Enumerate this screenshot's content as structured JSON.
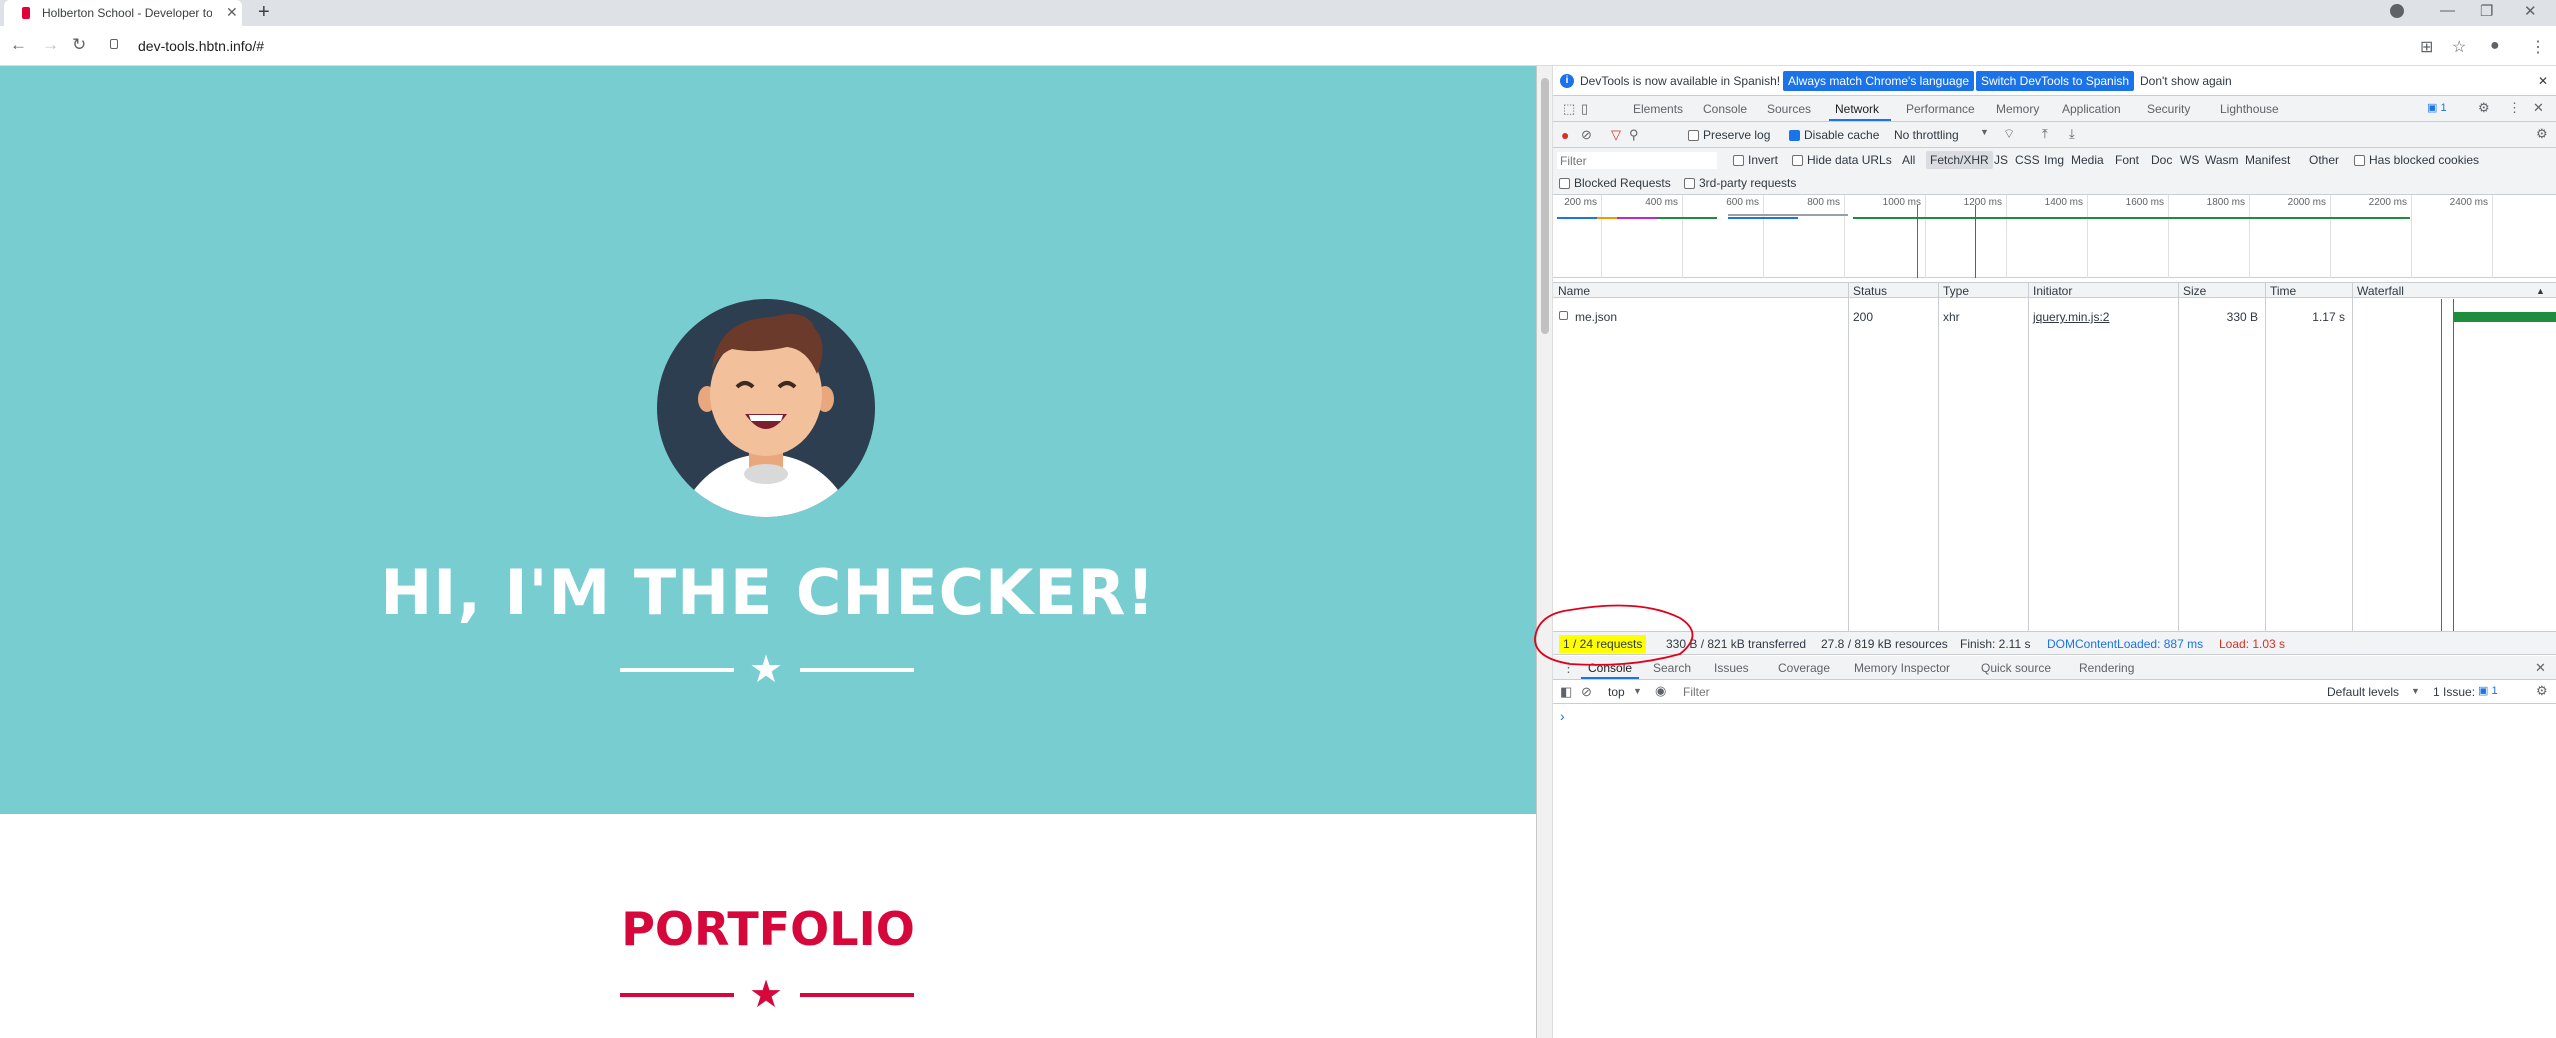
{
  "browser": {
    "tab_title": "Holberton School - Developer to",
    "tab_close": "✕",
    "new_tab": "+",
    "url": "dev-tools.hbtn.info/#"
  },
  "page": {
    "hero_title": "HI, I'M THE CHECKER!",
    "portfolio_title": "PORTFOLIO",
    "colors": {
      "hero_bg": "#78cdd1",
      "accent": "#d6083b"
    }
  },
  "devtools": {
    "infobar": {
      "message": "DevTools is now available in Spanish!",
      "btn_match": "Always match Chrome's language",
      "btn_switch": "Switch DevTools to Spanish",
      "btn_dismiss": "Don't show again"
    },
    "tabs": [
      "Elements",
      "Console",
      "Sources",
      "Network",
      "Performance",
      "Memory",
      "Application",
      "Security",
      "Lighthouse"
    ],
    "active_tab": "Network",
    "issues_badge": "1",
    "network_toolbar": {
      "preserve_log": "Preserve log",
      "disable_cache": "Disable cache",
      "throttling": "No throttling"
    },
    "filter": {
      "placeholder": "Filter",
      "invert": "Invert",
      "hide_data_urls": "Hide data URLs",
      "types": [
        "All",
        "Fetch/XHR",
        "JS",
        "CSS",
        "Img",
        "Media",
        "Font",
        "Doc",
        "WS",
        "Wasm",
        "Manifest",
        "Other"
      ],
      "active_type": "Fetch/XHR",
      "has_blocked_cookies": "Has blocked cookies",
      "blocked_requests": "Blocked Requests",
      "third_party": "3rd-party requests"
    },
    "overview_ticks": [
      "200 ms",
      "400 ms",
      "600 ms",
      "800 ms",
      "1000 ms",
      "1200 ms",
      "1400 ms",
      "1600 ms",
      "1800 ms",
      "2000 ms",
      "2200 ms",
      "2400 ms"
    ],
    "columns": [
      "Name",
      "Status",
      "Type",
      "Initiator",
      "Size",
      "Time",
      "Waterfall"
    ],
    "rows": [
      {
        "name": "me.json",
        "status": "200",
        "type": "xhr",
        "initiator": "jquery.min.js:2",
        "size": "330 B",
        "time": "1.17 s"
      }
    ],
    "summary": {
      "requests": "1 / 24 requests",
      "transferred": "330 B / 821 kB transferred",
      "resources": "27.8 / 819 kB resources",
      "finish": "Finish: 2.11 s",
      "dom_loaded": "DOMContentLoaded: 887 ms",
      "load": "Load: 1.03 s"
    },
    "drawer_tabs": [
      "Console",
      "Search",
      "Issues",
      "Coverage",
      "Memory Inspector",
      "Quick source",
      "Rendering"
    ],
    "console": {
      "context": "top",
      "filter_placeholder": "Filter",
      "levels": "Default levels",
      "issues": "1 Issue:",
      "issues_count": "1",
      "prompt": "›"
    }
  }
}
